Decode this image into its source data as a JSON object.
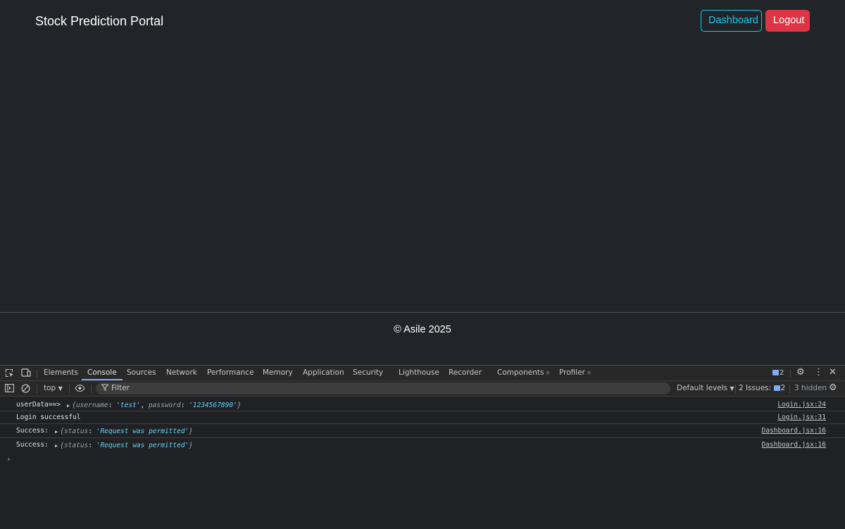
{
  "navbar": {
    "brand": "Stock Prediction Portal",
    "dashboard_label": "Dashboard",
    "logout_label": "Logout"
  },
  "footer": {
    "text": "© Asile 2025"
  },
  "devtools": {
    "tabs": [
      {
        "label": "Elements"
      },
      {
        "label": "Console"
      },
      {
        "label": "Sources"
      },
      {
        "label": "Network"
      },
      {
        "label": "Performance"
      },
      {
        "label": "Memory"
      },
      {
        "label": "Application"
      },
      {
        "label": "Security"
      },
      {
        "label": "Lighthouse"
      },
      {
        "label": "Recorder"
      },
      {
        "label": "Components"
      },
      {
        "label": "Profiler"
      }
    ],
    "active_tab": "Console",
    "message_count": "2",
    "toolbar": {
      "context": "top",
      "filter_placeholder": "Filter",
      "levels": "Default levels",
      "issues_label": "2 Issues:",
      "issues_count": "2",
      "hidden": "3 hidden"
    },
    "logs": [
      {
        "message": "userData==>",
        "object": {
          "open": "{",
          "k1": "username",
          "v1": "'test'",
          "k2": "password",
          "v2": "'1234567890'",
          "close": "}"
        },
        "source": "Login.jsx:24"
      },
      {
        "message": "Login successful",
        "source": "Login.jsx:31"
      },
      {
        "message": "Success:",
        "object": {
          "open": "{",
          "k1": "status",
          "v1": "'Request was permitted'",
          "close": "}"
        },
        "source": "Dashboard.jsx:16"
      },
      {
        "message": "Success:",
        "object": {
          "open": "{",
          "k1": "status",
          "v1": "'Request was permitted'",
          "close": "}"
        },
        "source": "Dashboard.jsx:16"
      }
    ],
    "prompt": "›"
  },
  "colors": {
    "page_bg": "#212529",
    "info_accent": "#0dcaf0",
    "danger": "#dc3545",
    "devtools_bg": "#202124",
    "string_value": "#5cd5fb"
  },
  "icons": {
    "inspect": "inspect-element-icon",
    "device": "device-toolbar-icon",
    "settings": "gear-icon",
    "more": "kebab-menu-icon",
    "close": "close-icon",
    "sidebar": "sidebar-toggle-icon",
    "clear": "clear-console-icon",
    "eye": "live-expression-eye-icon",
    "filter": "filter-funnel-icon"
  }
}
